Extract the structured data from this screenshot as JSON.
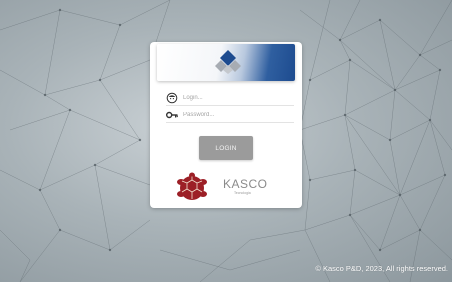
{
  "login_form": {
    "login_placeholder": "Login...",
    "password_placeholder": "Password...",
    "login_button": "LOGIN"
  },
  "brand": {
    "name": "KASCO",
    "tagline": "Tecnologia",
    "logo_icon": "turtle-icon",
    "accent_color": "#9c1f26"
  },
  "footer": {
    "copyright": "© Kasco P&D, 2023, All rights reserved."
  },
  "theme": {
    "banner_blue": "#1d4b8f",
    "button_gray": "#9b9b9b"
  }
}
